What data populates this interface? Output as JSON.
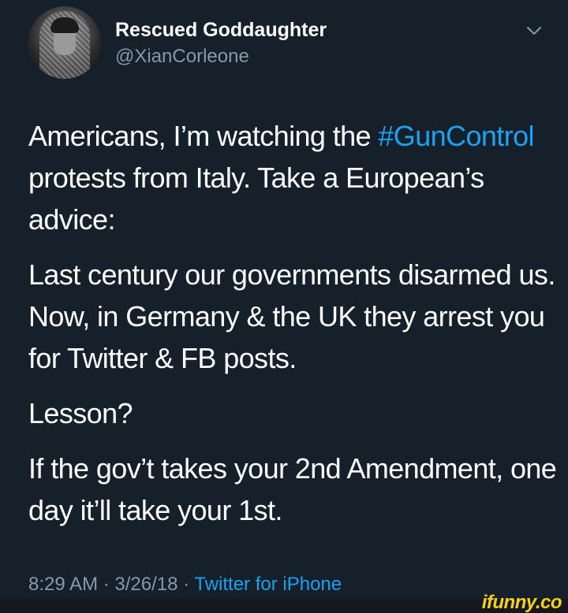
{
  "tweet": {
    "author": {
      "display_name": "Rescued Goddaughter",
      "handle": "@XianCorleone"
    },
    "paragraphs": {
      "p1": {
        "before": "Americans, I’m watching the ",
        "hashtag": "#GunControl",
        "after": " protests from Italy. Take a European’s advice:"
      },
      "p2": "Last century our governments disarmed us. Now, in Germany & the UK they arrest you for Twitter & FB posts.",
      "p3": "Lesson?",
      "p4": "If the gov’t takes your 2nd Amendment, one day it’ll take your 1st."
    },
    "meta": {
      "time": "8:29 AM",
      "separator_1": " · ",
      "date": "3/26/18",
      "separator_2": " · ",
      "source": "Twitter for iPhone"
    }
  },
  "watermark": "ifunny.co",
  "icons": {
    "menu": "chevron-down-icon"
  },
  "colors": {
    "background": "#15202b",
    "text": "#ffffff",
    "secondary_text": "#8899a6",
    "link": "#1da1f2",
    "watermark": "#f7d11b"
  }
}
